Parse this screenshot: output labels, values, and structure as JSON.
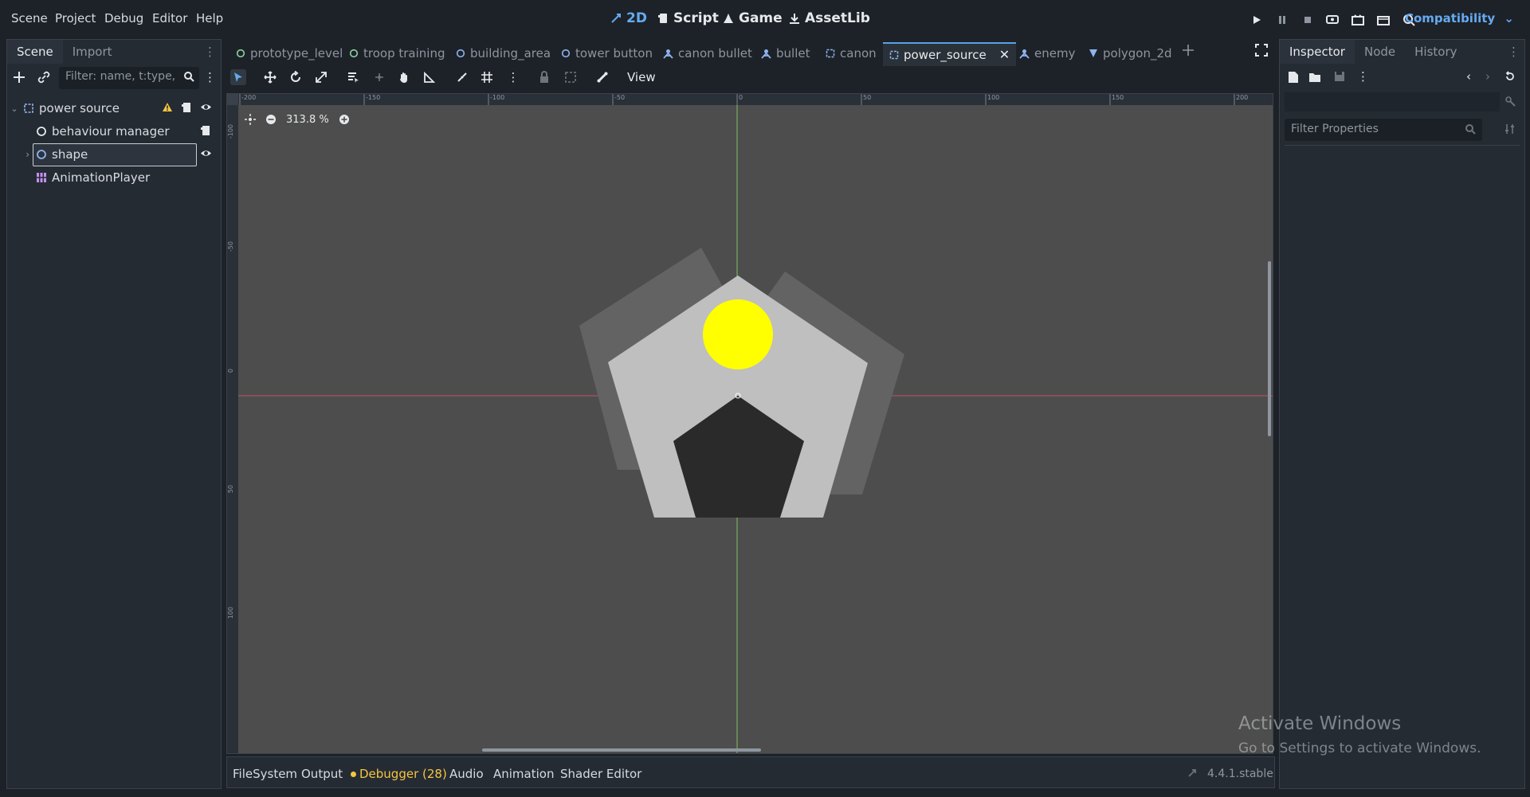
{
  "menu": {
    "scene": "Scene",
    "project": "Project",
    "debug": "Debug",
    "editor": "Editor",
    "help": "Help"
  },
  "workspaces": {
    "twod": "2D",
    "script": "Script",
    "game": "Game",
    "assetlib": "AssetLib"
  },
  "renderer": "Compatibility",
  "left_dock": {
    "tabs": [
      "Scene",
      "Import"
    ],
    "filter_placeholder": "Filter: name, t:type,",
    "tree": [
      {
        "label": "power source",
        "icon": "node2d-icon"
      },
      {
        "label": "behaviour manager",
        "icon": "node-icon"
      },
      {
        "label": "shape",
        "icon": "node2d-icon"
      },
      {
        "label": "AnimationPlayer",
        "icon": "animation-player-icon"
      }
    ]
  },
  "editor_tabs": [
    {
      "label": "prototype_level",
      "icon": "node-icon"
    },
    {
      "label": "troop training",
      "icon": "node-icon"
    },
    {
      "label": "building_area",
      "icon": "control-icon"
    },
    {
      "label": "tower button",
      "icon": "control-icon"
    },
    {
      "label": "canon bullet",
      "icon": "character-icon"
    },
    {
      "label": "bullet",
      "icon": "character-icon"
    },
    {
      "label": "canon",
      "icon": "node2d-icon"
    },
    {
      "label": "power_source",
      "icon": "node2d-icon"
    },
    {
      "label": "enemy",
      "icon": "character-icon"
    },
    {
      "label": "polygon_2d",
      "icon": "polygon-icon"
    }
  ],
  "viewport": {
    "view_menu": "View",
    "zoom": "313.8 %",
    "ruler_x_labels": [
      "-200",
      "-150",
      "-100",
      "-50",
      "0",
      "50",
      "100",
      "150",
      "200"
    ],
    "ruler_y_labels": [
      "-100",
      "-50",
      "0",
      "50",
      "100"
    ]
  },
  "right_dock": {
    "tabs": [
      "Inspector",
      "Node",
      "History"
    ],
    "filter_placeholder": "Filter Properties"
  },
  "bottom_panel": {
    "tabs": [
      "FileSystem",
      "Output",
      "Debugger (28)",
      "Audio",
      "Animation",
      "Shader Editor"
    ],
    "version": "4.4.1.stable"
  },
  "watermark": {
    "line1": "Activate Windows",
    "line2": "Go to Settings to activate Windows."
  },
  "colors": {
    "accent": "#65aaf0",
    "warning": "#f5c542",
    "debugger_dot": "#f5c542",
    "viewport_bg": "#4d4d4d"
  }
}
